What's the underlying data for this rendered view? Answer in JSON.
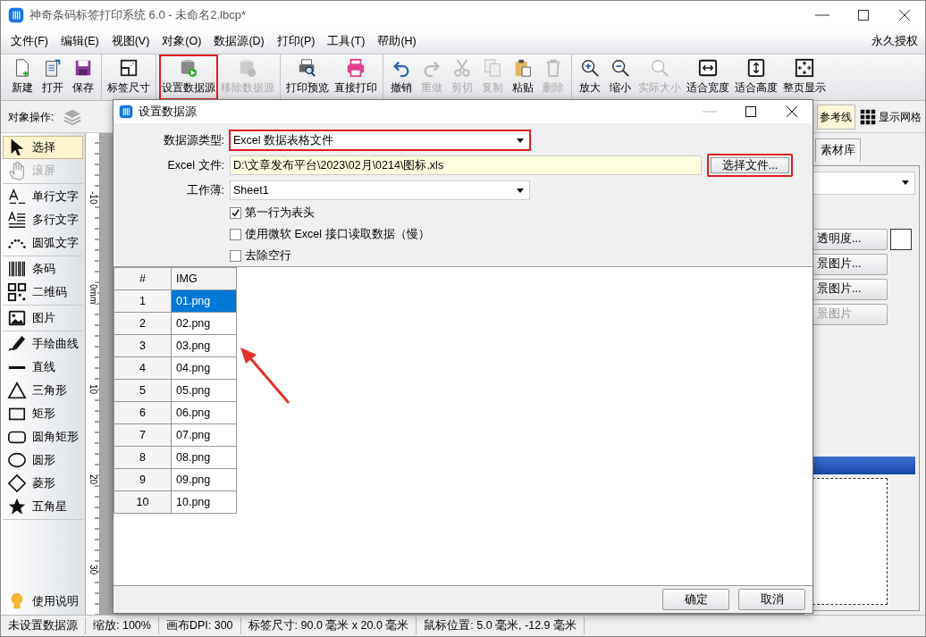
{
  "window": {
    "title": "神奇条码标签打印系统 6.0 - 未命名2.lbcp*"
  },
  "menu": [
    "文件(F)",
    "编辑(E)",
    "视图(V)",
    "对象(O)",
    "数据源(D)",
    "打印(P)",
    "工具(T)",
    "帮助(H)"
  ],
  "license": "永久授权",
  "toolbar": [
    [
      {
        "label": "新建",
        "disabled": false,
        "highlighted": false
      },
      {
        "label": "打开",
        "disabled": false,
        "highlighted": false
      },
      {
        "label": "保存",
        "disabled": false,
        "highlighted": false
      }
    ],
    [
      {
        "label": "标签尺寸",
        "disabled": false,
        "highlighted": false
      }
    ],
    [
      {
        "label": "设置数据源",
        "disabled": false,
        "highlighted": true
      },
      {
        "label": "移除数据源",
        "disabled": true,
        "highlighted": false
      }
    ],
    [
      {
        "label": "打印预览",
        "disabled": false,
        "highlighted": false
      },
      {
        "label": "直接打印",
        "disabled": false,
        "highlighted": false
      }
    ],
    [
      {
        "label": "撤销",
        "disabled": false,
        "highlighted": false
      },
      {
        "label": "重做",
        "disabled": true,
        "highlighted": false
      },
      {
        "label": "剪切",
        "disabled": true,
        "highlighted": false
      },
      {
        "label": "复制",
        "disabled": true,
        "highlighted": false
      },
      {
        "label": "粘贴",
        "disabled": false,
        "highlighted": false
      },
      {
        "label": "删除",
        "disabled": true,
        "highlighted": false
      }
    ],
    [
      {
        "label": "放大",
        "disabled": false,
        "highlighted": false
      },
      {
        "label": "缩小",
        "disabled": false,
        "highlighted": false
      },
      {
        "label": "实际大小",
        "disabled": true,
        "highlighted": false
      },
      {
        "label": "适合宽度",
        "disabled": false,
        "highlighted": false
      },
      {
        "label": "适合高度",
        "disabled": false,
        "highlighted": false
      },
      {
        "label": "整页显示",
        "disabled": false,
        "highlighted": false
      }
    ]
  ],
  "object_bar": {
    "label": "对象操作:",
    "guides": {
      "label": "参考线",
      "on": true
    },
    "grid": {
      "label": "显示网格"
    }
  },
  "tools": [
    [
      {
        "label": "选择",
        "selected": true,
        "disabled": false
      },
      {
        "label": "滚屏",
        "selected": false,
        "disabled": true
      }
    ],
    [
      {
        "label": "单行文字",
        "selected": false,
        "disabled": false
      },
      {
        "label": "多行文字",
        "selected": false,
        "disabled": false
      },
      {
        "label": "圆弧文字",
        "selected": false,
        "disabled": false
      }
    ],
    [
      {
        "label": "条码",
        "selected": false,
        "disabled": false
      },
      {
        "label": "二维码",
        "selected": false,
        "disabled": false
      }
    ],
    [
      {
        "label": "图片",
        "selected": false,
        "disabled": false
      }
    ],
    [
      {
        "label": "手绘曲线",
        "selected": false,
        "disabled": false
      },
      {
        "label": "直线",
        "selected": false,
        "disabled": false
      },
      {
        "label": "三角形",
        "selected": false,
        "disabled": false
      },
      {
        "label": "矩形",
        "selected": false,
        "disabled": false
      },
      {
        "label": "圆角矩形",
        "selected": false,
        "disabled": false
      },
      {
        "label": "圆形",
        "selected": false,
        "disabled": false
      },
      {
        "label": "菱形",
        "selected": false,
        "disabled": false
      },
      {
        "label": "五角星",
        "selected": false,
        "disabled": false
      }
    ]
  ],
  "help": "使用说明",
  "ruler": [
    "-10",
    "0mm",
    "10",
    "20",
    "30"
  ],
  "right_panel": {
    "tab": "素材库",
    "buttons": [
      {
        "label": "透明度...",
        "disabled": false
      },
      {
        "label": "景图片...",
        "disabled": false
      },
      {
        "label": "景图片...",
        "disabled": false
      },
      {
        "label": "景图片",
        "disabled": true
      }
    ]
  },
  "dialog": {
    "title": "设置数据源",
    "source_type": {
      "label": "数据源类型:",
      "value": "Excel 数据表格文件",
      "highlighted": true
    },
    "file": {
      "label": "Excel 文件:",
      "value": "D:\\文章发布平台\\2023\\02月\\0214\\图标.xls"
    },
    "choose_button": {
      "label": "选择文件...",
      "highlighted": true
    },
    "sheet": {
      "label": "工作薄:",
      "value": "Sheet1"
    },
    "options": [
      {
        "label": "第一行为表头",
        "checked": true
      },
      {
        "label": "使用微软 Excel 接口读取数据（慢）",
        "checked": false
      },
      {
        "label": "去除空行",
        "checked": false
      }
    ],
    "table": {
      "columns": [
        "#",
        "IMG"
      ],
      "rows": [
        {
          "index": "1",
          "img": "01.png",
          "selected": true
        },
        {
          "index": "2",
          "img": "02.png",
          "selected": false
        },
        {
          "index": "3",
          "img": "03.png",
          "selected": false
        },
        {
          "index": "4",
          "img": "04.png",
          "selected": false
        },
        {
          "index": "5",
          "img": "05.png",
          "selected": false
        },
        {
          "index": "6",
          "img": "06.png",
          "selected": false
        },
        {
          "index": "7",
          "img": "07.png",
          "selected": false
        },
        {
          "index": "8",
          "img": "08.png",
          "selected": false
        },
        {
          "index": "9",
          "img": "09.png",
          "selected": false
        },
        {
          "index": "10",
          "img": "10.png",
          "selected": false
        }
      ]
    },
    "buttons": [
      "确定",
      "取消"
    ]
  },
  "status_bar": [
    "未设置数据源",
    "缩放: 100%",
    "画布DPI: 300",
    "标签尺寸: 90.0 毫米 x 20.0 毫米",
    "鼠标位置: 5.0 毫米, -12.9 毫米"
  ]
}
